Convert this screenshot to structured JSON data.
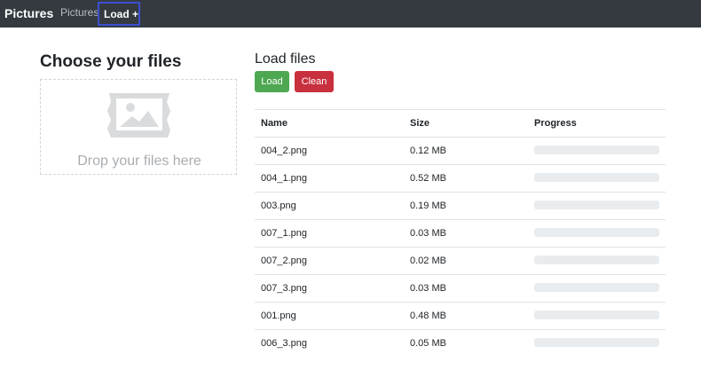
{
  "navbar": {
    "brand": "Pictures",
    "links": [
      {
        "label": "Pictures"
      },
      {
        "label": "Load +"
      }
    ]
  },
  "upload": {
    "title": "Choose your files",
    "drop_text": "Drop your files here",
    "icon": "image-icon"
  },
  "files_panel": {
    "title": "Load files",
    "load_button": "Load",
    "clean_button": "Clean",
    "columns": [
      "Name",
      "Size",
      "Progress"
    ],
    "rows": [
      {
        "name": "004_2.png",
        "size": "0.12 MB",
        "progress": 0
      },
      {
        "name": "004_1.png",
        "size": "0.52 MB",
        "progress": 0
      },
      {
        "name": "003.png",
        "size": "0.19 MB",
        "progress": 0
      },
      {
        "name": "007_1.png",
        "size": "0.03 MB",
        "progress": 0
      },
      {
        "name": "007_2.png",
        "size": "0.02 MB",
        "progress": 0
      },
      {
        "name": "007_3.png",
        "size": "0.03 MB",
        "progress": 0
      },
      {
        "name": "001.png",
        "size": "0.48 MB",
        "progress": 0
      },
      {
        "name": "006_3.png",
        "size": "0.05 MB",
        "progress": 0
      }
    ]
  },
  "colors": {
    "navbar": "#343a40",
    "load_button": "#4ea852",
    "clean_button": "#c9303e",
    "progress_track": "#e9ecef"
  }
}
